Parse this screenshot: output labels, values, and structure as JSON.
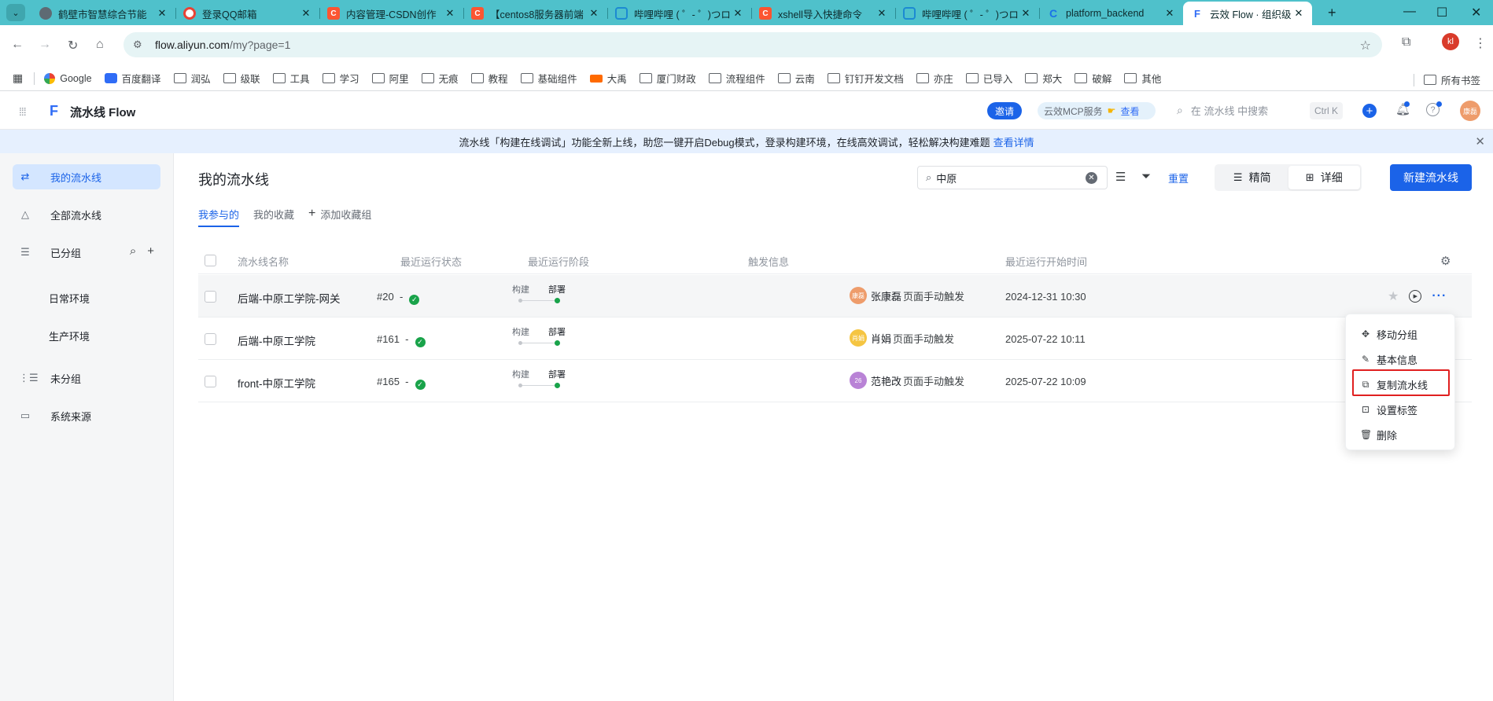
{
  "browser": {
    "tabs": [
      {
        "title": "鹤壁市智慧综合节能",
        "icon": "globe-icon"
      },
      {
        "title": "登录QQ邮箱",
        "icon": "google-icon"
      },
      {
        "title": "内容管理-CSDN创作",
        "icon": "csdn-icon"
      },
      {
        "title": "【centos8服务器前端",
        "icon": "csdn-icon"
      },
      {
        "title": "哔哩哔哩 ( ゜- ゜)つロ",
        "icon": "bilibili-icon"
      },
      {
        "title": "xshell导入快捷命令",
        "icon": "csdn-icon"
      },
      {
        "title": "哔哩哔哩 ( ゜- ゜)つロ",
        "icon": "bilibili-icon"
      },
      {
        "title": "platform_backend",
        "icon": "cloud-icon"
      },
      {
        "title": "云效 Flow · 组织级",
        "icon": "flow-icon",
        "active": true
      }
    ],
    "url_host": "flow.aliyun.com",
    "url_path": "/my?page=1",
    "profile_initials": "kl",
    "bookmarks": [
      "Google",
      "百度翻译",
      "润弘",
      "级联",
      "工具",
      "学习",
      "阿里",
      "无痕",
      "教程",
      "基础组件",
      "大禹",
      "厦门财政",
      "流程组件",
      "云南",
      "钉钉开发文档",
      "亦庄",
      "已导入",
      "郑大",
      "破解",
      "其他"
    ],
    "bookmarks_right": "所有书签"
  },
  "header": {
    "brand": "流水线 Flow",
    "invite": "邀请",
    "mcp_label": "云效MCP服务",
    "mcp_link": "查看",
    "search_placeholder": "在 流水线 中搜索",
    "shortcut": "Ctrl K",
    "avatar_text": "康磊"
  },
  "notice": {
    "text": "流水线「构建在线调试」功能全新上线，助您一键开启Debug模式，登录构建环境，在线高效调试，轻松解决构建难题",
    "link": "查看详情"
  },
  "sidebar": {
    "items": [
      {
        "label": "我的流水线",
        "icon": "pipeline-icon"
      },
      {
        "label": "全部流水线",
        "icon": "nodes-icon"
      },
      {
        "label": "已分组",
        "icon": "list-icon"
      },
      {
        "label": "未分组",
        "icon": "ungrouped-icon"
      },
      {
        "label": "系统来源",
        "icon": "monitor-icon"
      }
    ],
    "groups": [
      "日常环境",
      "生产环境"
    ]
  },
  "main": {
    "title": "我的流水线",
    "search_value": "中原",
    "reset": "重置",
    "view_simple": "精简",
    "view_detail": "详细",
    "new_button": "新建流水线",
    "tabs": [
      "我参与的",
      "我的收藏",
      "添加收藏组"
    ],
    "columns": [
      "流水线名称",
      "最近运行状态",
      "最近运行阶段",
      "触发信息",
      "最近运行开始时间"
    ],
    "stage_labels": [
      "构建",
      "部署"
    ],
    "rows": [
      {
        "name": "后端-中原工学院-网关",
        "run": "#20",
        "sep": "-",
        "avatar": "康磊",
        "avatar_color": "#ee9c6b",
        "user": "张康磊",
        "trigger": "页面手动触发",
        "time": "2024-12-31 10:30"
      },
      {
        "name": "后端-中原工学院",
        "run": "#161",
        "sep": "-",
        "avatar": "肖娟",
        "avatar_color": "#f5c542",
        "user": "肖娟",
        "trigger": "页面手动触发",
        "time": "2025-07-22 10:11"
      },
      {
        "name": "front-中原工学院",
        "run": "#165",
        "sep": "-",
        "avatar": "26",
        "avatar_color": "#b983d6",
        "user": "范艳改",
        "trigger": "页面手动触发",
        "time": "2025-07-22 10:09"
      }
    ]
  },
  "menu": {
    "items": [
      {
        "label": "移动分组",
        "icon": "move-icon"
      },
      {
        "label": "基本信息",
        "icon": "edit-icon"
      },
      {
        "label": "复制流水线",
        "icon": "copy-icon",
        "highlight": true
      },
      {
        "label": "设置标签",
        "icon": "tag-icon"
      },
      {
        "label": "删除",
        "icon": "trash-icon"
      }
    ]
  }
}
